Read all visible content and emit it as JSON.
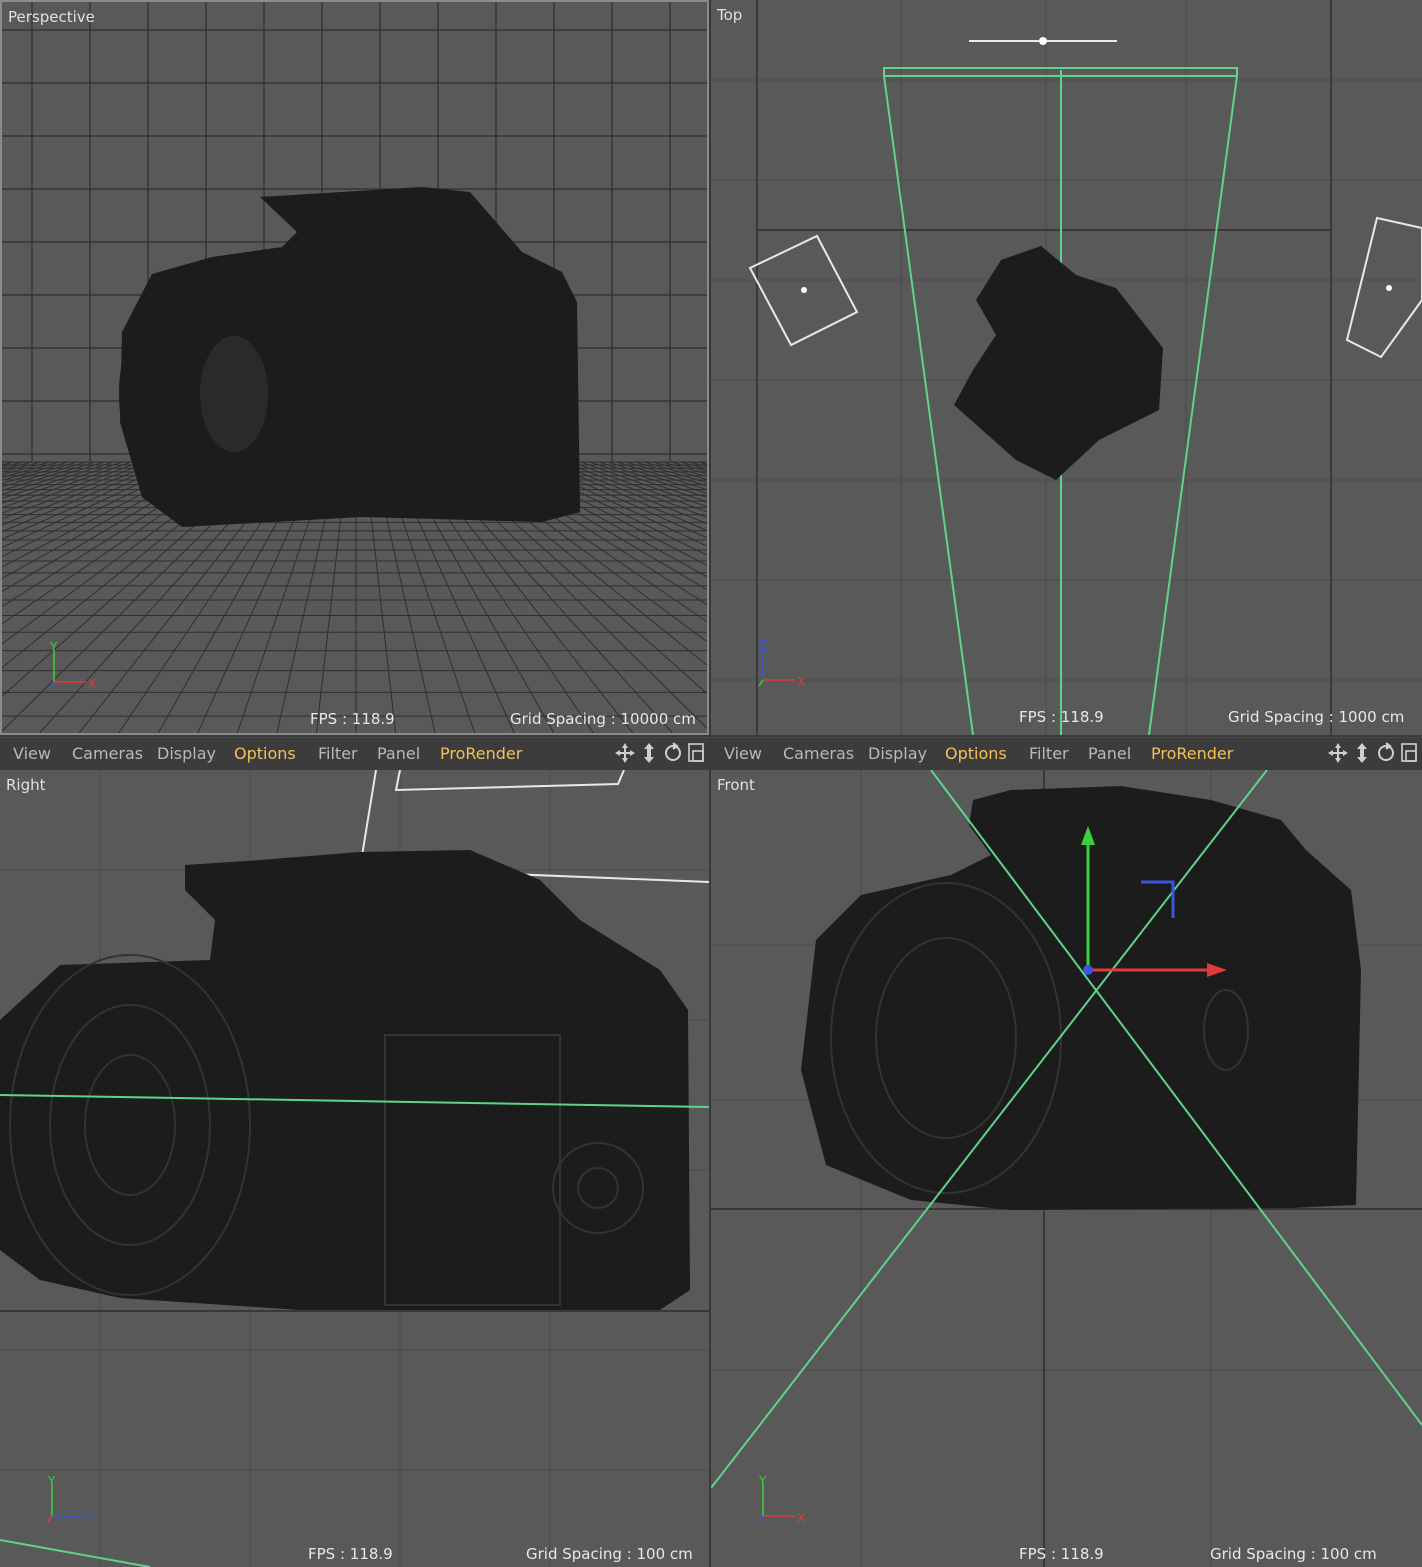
{
  "viewports": {
    "perspective": {
      "name": "Perspective",
      "fps": "FPS : 118.9",
      "grid_spacing": "Grid Spacing : 10000 cm",
      "axis": {
        "v": "Y",
        "h": "X"
      }
    },
    "top": {
      "name": "Top",
      "fps": "FPS : 118.9",
      "grid_spacing": "Grid Spacing : 1000 cm",
      "axis": {
        "v": "Z",
        "h": "X"
      }
    },
    "right": {
      "name": "Right",
      "fps": "FPS : 118.9",
      "grid_spacing": "Grid Spacing : 100 cm",
      "axis": {
        "v": "Y",
        "h": "Z"
      }
    },
    "front": {
      "name": "Front",
      "fps": "FPS : 118.9",
      "grid_spacing": "Grid Spacing : 100 cm",
      "axis": {
        "v": "Y",
        "h": "X"
      }
    }
  },
  "menu": {
    "view": "View",
    "cameras": "Cameras",
    "display": "Display",
    "options": "Options",
    "filter": "Filter",
    "panel": "Panel",
    "prorender": "ProRender"
  },
  "colors": {
    "viewport_bg": "#595959",
    "grid": "#4b4b4b",
    "mesh": "#1c1c1c",
    "camera_frustum": "#5fd38a",
    "highlight_menu": "#f2c15a",
    "axis_x": "#e03a3a",
    "axis_y": "#3ad23a",
    "axis_z": "#3a55e0"
  },
  "icons": [
    "move-view-icon",
    "zoom-view-icon",
    "rotate-view-icon",
    "maximize-view-icon"
  ]
}
